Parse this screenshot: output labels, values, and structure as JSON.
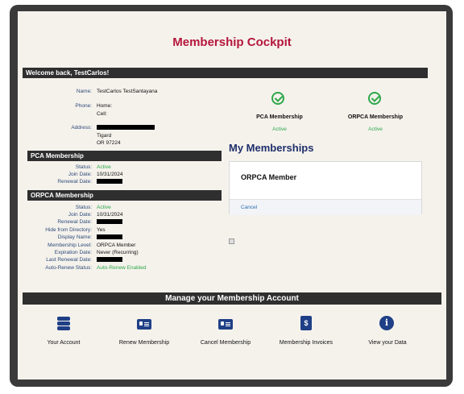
{
  "header": {
    "title": "Membership Cockpit"
  },
  "welcome": {
    "text": "Welcome back, TestCarlos!"
  },
  "contact": {
    "name_label": "Name:",
    "name_value": "TestCarlos TestSantayana",
    "phone_label": "Phone:",
    "phone_home": "Home:",
    "phone_cell": "Cell:",
    "address_label": "Address:",
    "address_city": "Tigard",
    "address_state_zip": "OR 97224"
  },
  "pca_section": {
    "heading": "PCA Membership",
    "status_label": "Status:",
    "status_value": "Active",
    "join_label": "Join Date:",
    "join_value": "10/31/2024",
    "renewal_label": "Renewal Date:"
  },
  "orpca_section": {
    "heading": "ORPCA Membership",
    "status_label": "Status:",
    "status_value": "Active",
    "join_label": "Join Date:",
    "join_value": "10/31/2024",
    "renewal_label": "Renewal Date:",
    "hide_label": "Hide from Directory:",
    "hide_value": "Yes",
    "display_label": "Display Name:",
    "level_label": "Membership Level:",
    "level_value": "ORPCA Member",
    "expiration_label": "Expiration Date:",
    "expiration_value": "Never (Recurring)",
    "last_renewal_label": "Last Renewal Date:",
    "autorenew_label": "Auto-Renew Status:",
    "autorenew_value": "Auto-Renew Enabled"
  },
  "badges": [
    {
      "name": "PCA Membership",
      "status": "Active"
    },
    {
      "name": "ORPCA Membership",
      "status": "Active"
    }
  ],
  "my_memberships": {
    "heading": "My Memberships",
    "card_title": "ORPCA Member",
    "cancel_link": "Cancel"
  },
  "manage": {
    "heading": "Manage your Membership Account",
    "actions": [
      {
        "label": "Your Account",
        "icon": "layers-icon"
      },
      {
        "label": "Renew Membership",
        "icon": "id-card-icon"
      },
      {
        "label": "Cancel Membership",
        "icon": "id-card-icon"
      },
      {
        "label": "Membership Invoices",
        "icon": "invoice-icon"
      },
      {
        "label": "View your Data",
        "icon": "info-icon"
      }
    ]
  },
  "colors": {
    "title_red": "#b5163b",
    "label_blue": "#2e4a7a",
    "active_green": "#2ea84a",
    "icon_navy": "#1f3f86",
    "bar_dark": "#2f2f2f"
  }
}
